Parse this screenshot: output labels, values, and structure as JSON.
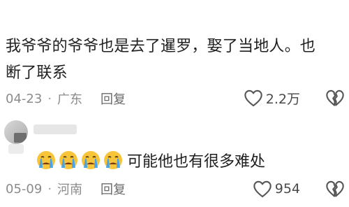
{
  "comments": [
    {
      "text_line1": "我爷爷的爷爷也是去了暹罗，娶了当地人。也",
      "text_line2": "断了联系",
      "date": "04-23",
      "location": "广东",
      "reply_label": "回复",
      "likes": "2.2万"
    },
    {
      "emoji_icon": "crying-face",
      "emoji_count": 4,
      "text": "可能他也有很多难处",
      "date": "05-09",
      "location": "河南",
      "reply_label": "回复",
      "likes": "954"
    }
  ],
  "colors": {
    "text": "#1f1f1f",
    "meta": "#8b8b8b",
    "emoji_face": "#f7c53a",
    "emoji_tear": "#4aa3e8"
  },
  "separator": "·"
}
